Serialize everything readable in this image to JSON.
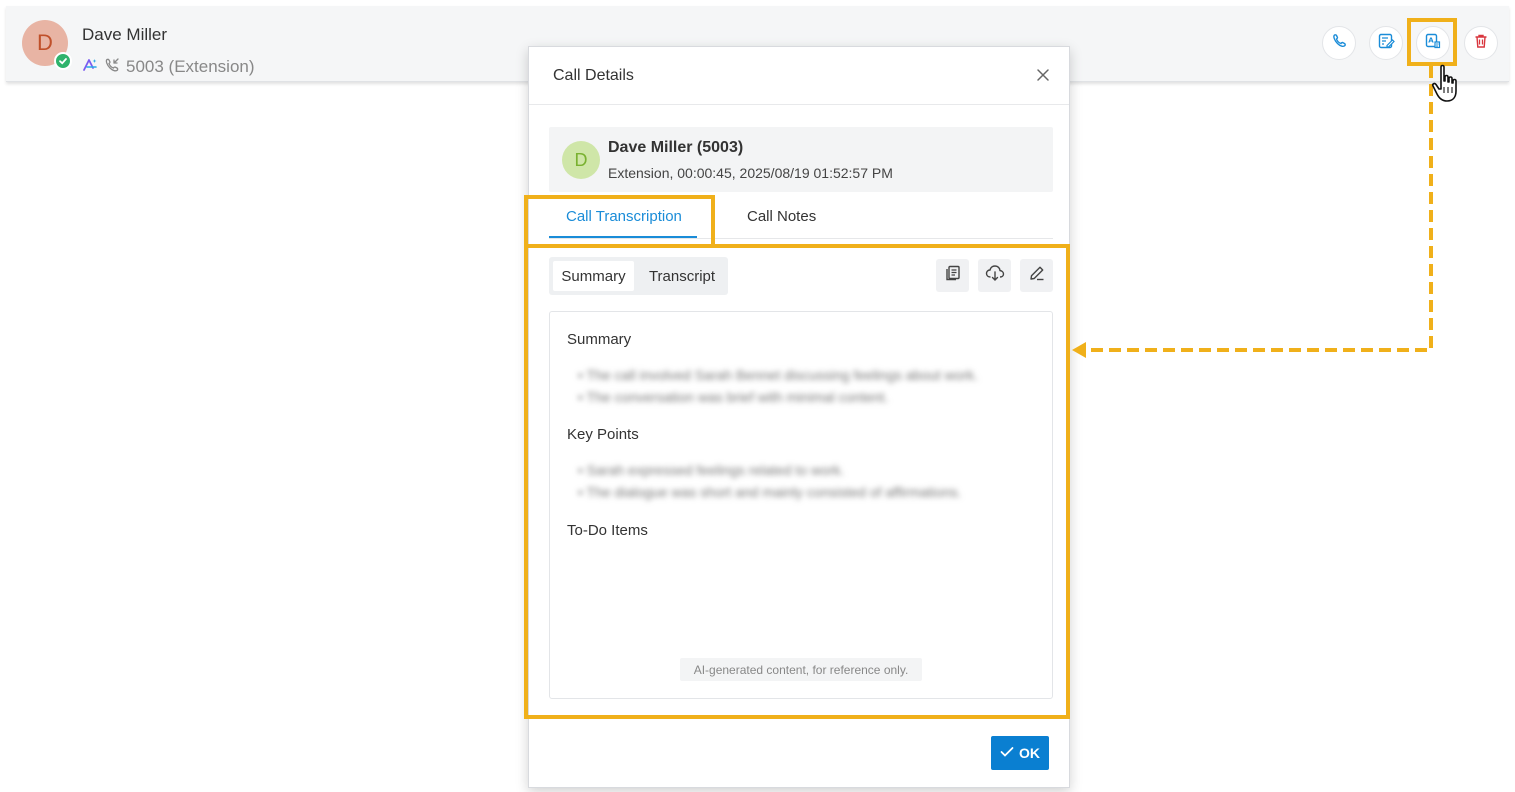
{
  "contact": {
    "avatar_letter": "D",
    "name": "Dave Miller",
    "extension_text": "5003 (Extension)",
    "presence_color": "#2fb36c",
    "actions": [
      {
        "icon": "phone-icon"
      },
      {
        "icon": "edit-note-icon"
      },
      {
        "icon": "ai-transcription-icon"
      },
      {
        "icon": "trash-icon"
      }
    ]
  },
  "dialog": {
    "title": "Call Details",
    "caller": {
      "avatar_letter": "D",
      "name": "Dave Miller (5003)",
      "meta": "Extension, 00:00:45, 2025/08/19 01:52:57 PM"
    },
    "tabs": [
      "Call Transcription",
      "Call Notes"
    ],
    "active_tab": "Call Transcription",
    "segments": [
      "Summary",
      "Transcript"
    ],
    "active_segment": "Summary",
    "tools": [
      "copy-icon",
      "cloud-download-icon",
      "edit-icon"
    ],
    "content": {
      "summary_title": "Summary",
      "summary_items": [
        "The call involved Sarah Bennet discussing feelings about work.",
        "The conversation was brief with minimal content."
      ],
      "key_points_title": "Key Points",
      "key_points_items": [
        "Sarah expressed feelings related to work.",
        "The dialogue was short and mainly consisted of affirmations."
      ],
      "todo_title": "To-Do Items",
      "ai_note": "AI-generated content, for reference only."
    },
    "ok_label": "OK"
  },
  "colors": {
    "accent": "#1a8cd8",
    "highlight": "#f0b01a",
    "ok_button": "#0a7fd1",
    "delete": "#d9363e"
  }
}
